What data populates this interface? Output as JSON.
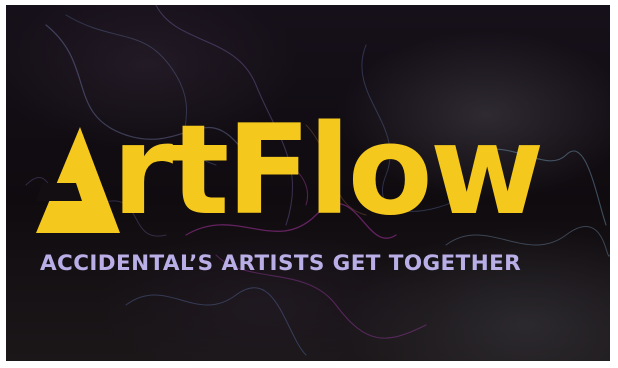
{
  "logo": {
    "letter_a_rendered_as": "stylized-triangle-a-glyph",
    "wordmark_rest": "rtFlow",
    "accent_color": "#f4c81c"
  },
  "tagline": {
    "text": "ACCIDENTAL’S ARTISTS GET TOGETHER",
    "color": "#b9aee6"
  },
  "background": {
    "base_color": "#120e11",
    "effect": "colored smoke"
  }
}
